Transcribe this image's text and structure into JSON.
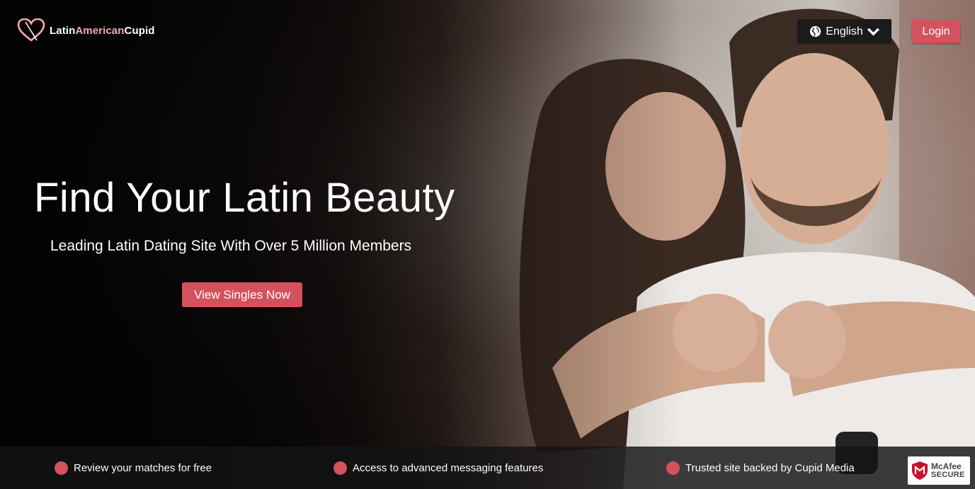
{
  "brand": {
    "name_part1": "Latin",
    "name_part2": "American",
    "name_part3": "Cupid",
    "logo_icon": "heart-logo-icon",
    "accent_color": "#f3a9b4"
  },
  "header": {
    "language_label": "English",
    "language_icon": "globe-icon",
    "login_label": "Login"
  },
  "hero": {
    "headline": "Find Your Latin Beauty",
    "subheadline": "Leading Latin Dating Site With Over 5 Million Members",
    "cta_label": "View Singles Now"
  },
  "features": [
    {
      "label": "Review your matches for free"
    },
    {
      "label": "Access to advanced messaging features"
    },
    {
      "label": "Trusted site backed by Cupid Media"
    }
  ],
  "badge": {
    "brand": "McAfee",
    "secure": "SECURE",
    "icon": "mcafee-shield-icon"
  },
  "colors": {
    "primary_button": "#d4525e",
    "language_button_bg": "#1b1b1b",
    "feature_bar_bg": "#141414"
  }
}
